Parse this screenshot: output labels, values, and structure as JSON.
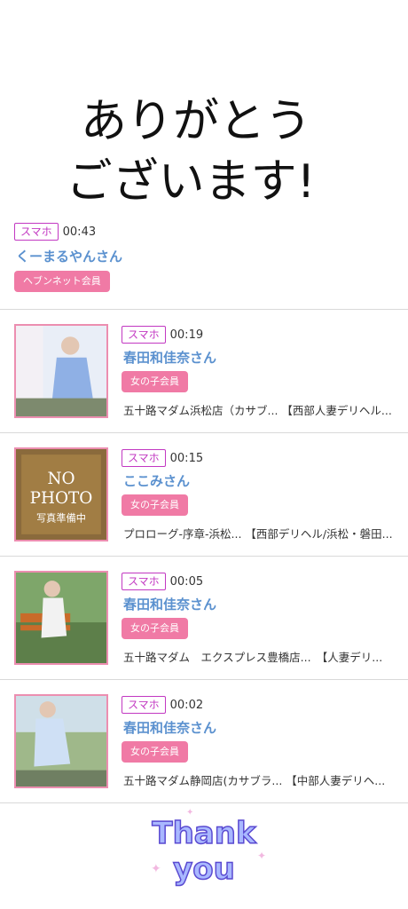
{
  "hero": {
    "line1": "ありがとう",
    "line2": "ございます!"
  },
  "entries": [
    {
      "badge": "スマホ",
      "time": "00:43",
      "name": "くーまるやんさん",
      "tag": "ヘブンネット会員"
    },
    {
      "badge": "スマホ",
      "time": "00:19",
      "name": "春田和佳奈さん",
      "tag": "女の子会員",
      "shop": "五十路マダム浜松店（カサブ... 【西部人妻デリヘル..."
    },
    {
      "badge": "スマホ",
      "time": "00:15",
      "name": "ここみさん",
      "tag": "女の子会員",
      "shop": "プロローグ-序章-浜松... 【西部デリヘル/浜松・磐田...",
      "thumb_text": [
        "NO",
        "PHOTO",
        "写真準備中"
      ]
    },
    {
      "badge": "スマホ",
      "time": "00:05",
      "name": "春田和佳奈さん",
      "tag": "女の子会員",
      "shop": "五十路マダム　エクスプレス豊橋店...　【人妻デリ..."
    },
    {
      "badge": "スマホ",
      "time": "00:02",
      "name": "春田和佳奈さん",
      "tag": "女の子会員",
      "shop": "五十路マダム静岡店(カサブラ... 【中部人妻デリヘ..."
    }
  ],
  "footer": {
    "line1": "Thank",
    "line2": "you"
  },
  "colors": {
    "name": "#5b91cf",
    "tag_bg": "#f07aa5",
    "badge": "#c238c2"
  }
}
